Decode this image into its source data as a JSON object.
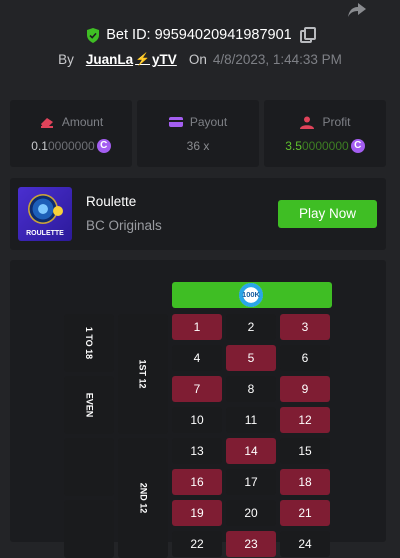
{
  "header": {
    "bet_label": "Bet ID: 99594020941987901",
    "by_label": "By",
    "user_name_a": "JuanLa",
    "user_name_b": "yTV",
    "on_label": "On",
    "date": "4/8/2023, 1:44:33 PM"
  },
  "stats": {
    "amount": {
      "label": "Amount",
      "value_bright": "0.1",
      "value_dim": "0000000",
      "coin": "C"
    },
    "payout": {
      "label": "Payout",
      "value": "36 x"
    },
    "profit": {
      "label": "Profit",
      "value_bright": "3.5",
      "value_dim": "0000000",
      "coin": "C"
    }
  },
  "game": {
    "name": "Roulette",
    "provider": "BC Originals",
    "thumb_text": "ROULETTE",
    "play_label": "Play Now"
  },
  "board": {
    "chip_label": "100K",
    "outside": {
      "one_to_18": "1 TO 18",
      "even": "EVEN",
      "first_12": "1ST 12",
      "second_12": "2ND 12"
    },
    "numbers": [
      [
        "1",
        "2",
        "3"
      ],
      [
        "4",
        "5",
        "6"
      ],
      [
        "7",
        "8",
        "9"
      ],
      [
        "10",
        "11",
        "12"
      ],
      [
        "13",
        "14",
        "15"
      ],
      [
        "16",
        "17",
        "18"
      ],
      [
        "19",
        "20",
        "21"
      ],
      [
        "22",
        "23",
        "24"
      ]
    ]
  },
  "colors": {
    "accent_green": "#3fbe24",
    "roulette_red": "#7f1d33",
    "coin_purple": "#a45ef1"
  }
}
